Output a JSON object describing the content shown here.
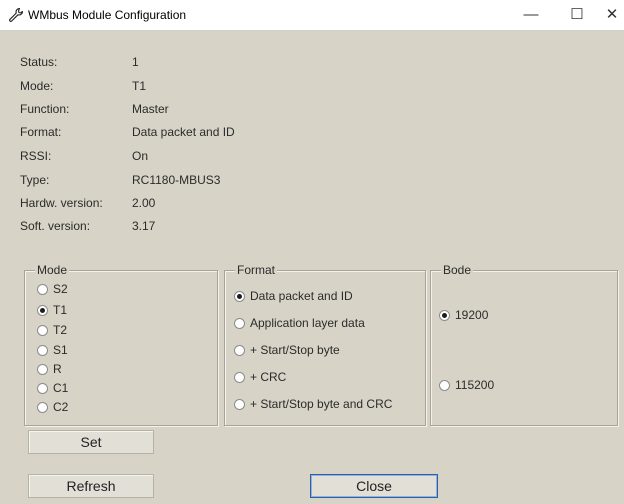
{
  "window": {
    "title": "WMbus Module Configuration",
    "icon": "wrench-icon",
    "minimize_glyph": "—",
    "maximize_glyph": "☐",
    "close_glyph": "✕"
  },
  "info": [
    {
      "label": "Status:",
      "value": "1"
    },
    {
      "label": "Mode:",
      "value": "T1"
    },
    {
      "label": "Function:",
      "value": "Master"
    },
    {
      "label": "Format:",
      "value": "Data packet and ID"
    },
    {
      "label": "RSSI:",
      "value": "On"
    },
    {
      "label": "Type:",
      "value": "RC1180-MBUS3"
    },
    {
      "label": "Hardw. version:",
      "value": "2.00"
    },
    {
      "label": "Soft. version:",
      "value": "3.17"
    }
  ],
  "mode_group": {
    "legend": "Mode",
    "selected": "T1",
    "options": [
      "S2",
      "T1",
      "T2",
      "S1",
      "R",
      "C1",
      "C2"
    ]
  },
  "format_group": {
    "legend": "Format",
    "selected": "Data packet and ID",
    "options": [
      "Data packet and ID",
      "Application layer data",
      "+ Start/Stop byte",
      "+ CRC",
      "+ Start/Stop byte and CRC"
    ]
  },
  "bode_group": {
    "legend": "Bode",
    "selected": "19200",
    "options": [
      "19200",
      "115200"
    ]
  },
  "buttons": {
    "set": "Set",
    "refresh": "Refresh",
    "close": "Close"
  }
}
